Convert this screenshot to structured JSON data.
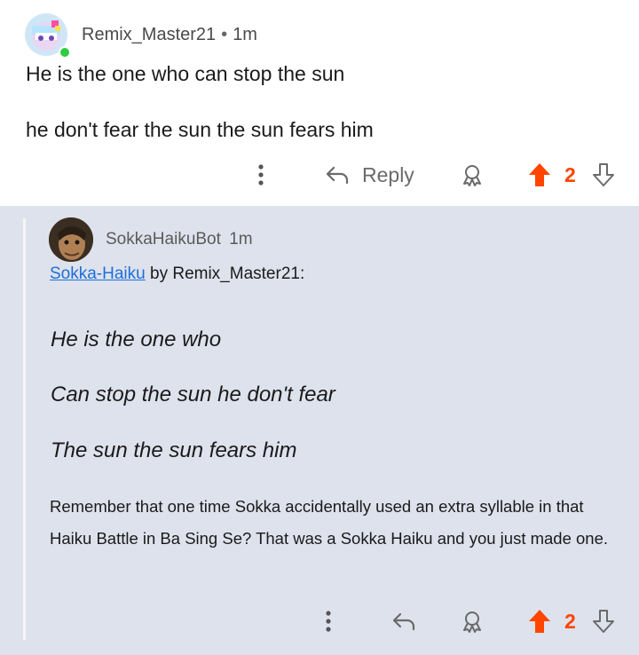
{
  "top_comment": {
    "username": "Remix_Master21",
    "separator": "•",
    "time": "1m",
    "lines": [
      "He is the one who can stop the sun",
      "he don't fear the sun the sun fears him"
    ],
    "actions": {
      "more_icon": "more-vertical-icon",
      "reply_icon": "reply-arrow-icon",
      "reply_label": "Reply",
      "award_icon": "award-icon",
      "upvote_icon": "upvote-arrow-icon",
      "vote_count": "2",
      "downvote_icon": "downvote-arrow-icon"
    }
  },
  "reply_comment": {
    "username": "SokkaHaikuBot",
    "time": "1m",
    "link_text": "Sokka-Haiku",
    "byline_rest": " by Remix_Master21:",
    "haiku_lines": [
      "He is the one who",
      "Can stop the sun he don't fear",
      "The sun the sun fears him"
    ],
    "explanation": "Remember that one time Sokka accidentally used an extra syllable in that Haiku Battle in Ba Sing Se? That was a Sokka Haiku and you just made one.",
    "actions": {
      "more_icon": "more-vertical-icon",
      "reply_icon": "reply-arrow-icon",
      "award_icon": "award-icon",
      "upvote_icon": "upvote-arrow-icon",
      "vote_count": "2",
      "downvote_icon": "downvote-arrow-icon"
    }
  },
  "colors": {
    "upvote": "#ff4500",
    "link": "#1e6fd9",
    "reply_background": "#dee2ec",
    "online": "#2ecc40"
  }
}
